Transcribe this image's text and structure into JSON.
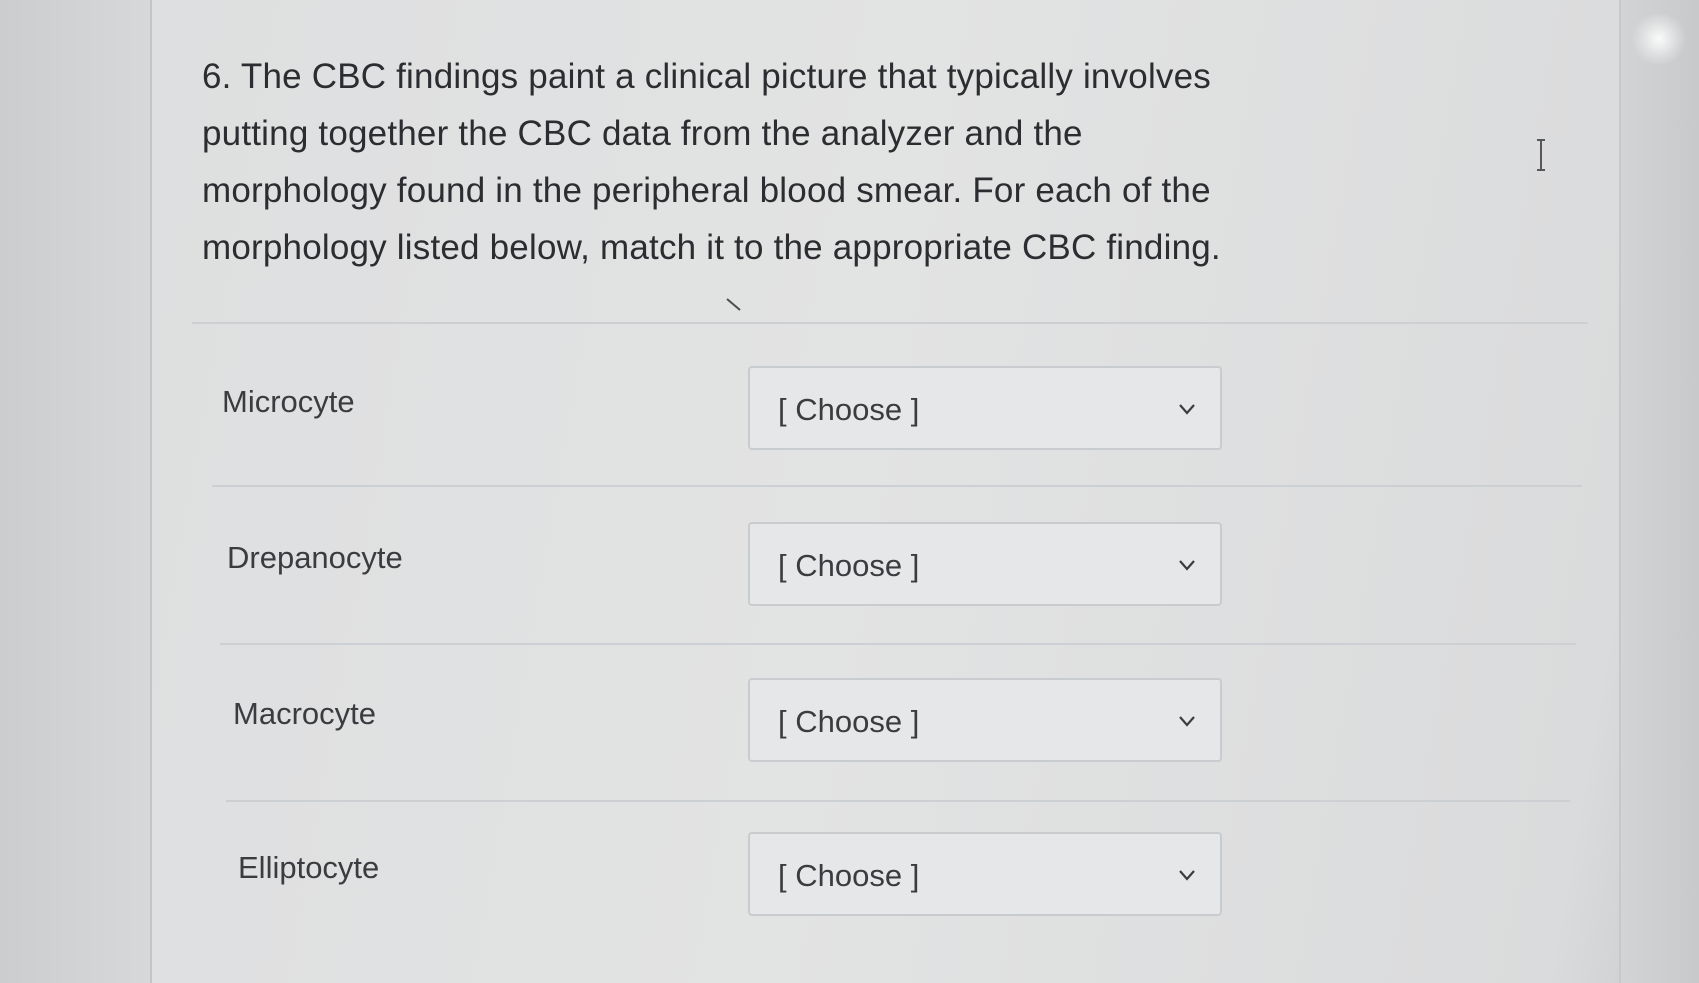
{
  "question": {
    "text": "6. The CBC findings paint a clinical picture that typically involves putting together the CBC data from the analyzer and the morphology found in the peripheral blood smear.  For each of the morphology listed below, match it to the appropriate CBC finding."
  },
  "matches": [
    {
      "term": "Microcyte",
      "selected": "[ Choose ]"
    },
    {
      "term": "Drepanocyte",
      "selected": "[ Choose ]"
    },
    {
      "term": "Macrocyte",
      "selected": "[ Choose ]"
    },
    {
      "term": "Elliptocyte",
      "selected": "[ Choose ]"
    }
  ],
  "icons": {
    "dropdown": "chevron-down-icon",
    "pointer": "mouse-cursor-icon",
    "text_cursor": "text-cursor-icon"
  },
  "colors": {
    "text": "#2b2d30",
    "select_border": "#c9ccce",
    "divider": "#cdd0d2"
  }
}
